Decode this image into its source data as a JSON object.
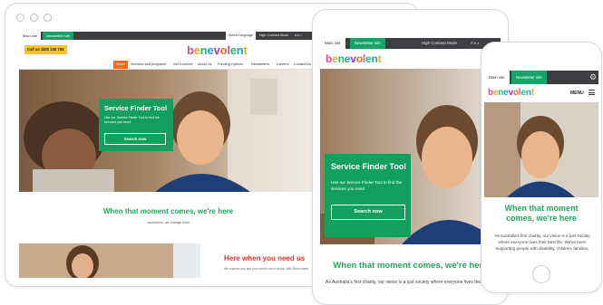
{
  "brand": {
    "logo_letters": [
      "b",
      "e",
      "n",
      "e",
      "v",
      "o",
      "l",
      "e",
      "n",
      "t"
    ],
    "logo_colors": [
      "#e84c8b",
      "#f5a623",
      "#2bb673",
      "#1e9fd8",
      "#8e44ad",
      "#f26522",
      "#e84c8b",
      "#2bb673",
      "#1e9fd8",
      "#f5a623"
    ]
  },
  "site": {
    "tab_main": "Main site",
    "tab_newsletter": "Newsletter site",
    "high_contrast": "High Contrast Mode",
    "select_language": "Select Language",
    "call_us": "Call us 1800 236 765",
    "menu_label": "MENU"
  },
  "nav": {
    "items": [
      "Home",
      "Services and programs",
      "Get Involved",
      "About Us",
      "Funding Options",
      "Newsletters",
      "Careers",
      "Contact Us"
    ]
  },
  "hero": {
    "service_finder_title": "Service Finder Tool",
    "service_finder_desc": "Use our Service Finder Tool to find the services you need",
    "search_button": "Search now"
  },
  "sections": {
    "moment_heading": "When that moment comes, we're here",
    "moment_sub": "volunteers, we change lives",
    "help_heading": "Here when you need us",
    "help_sub": "We support you and your loved one to thrive. With Benevolent,",
    "tablet_body": "As Australia's first charity, our vision is a just society where everyone lives their best life. We",
    "mobile_body": "As Australia's first charity, our vision is a just society where everyone lives their best life. We've been supporting people with disability, children, families,"
  },
  "colors": {
    "accent_green": "#23a65a",
    "newsletter_tab": "#14a46a",
    "call_button": "#f7c51e",
    "nav_active": "#f26a21",
    "topbar": "#3d3f42"
  },
  "icons": [
    "circle-dot-icon",
    "gear-icon",
    "menu-icon",
    "home-button-icon",
    "camera-icon"
  ]
}
